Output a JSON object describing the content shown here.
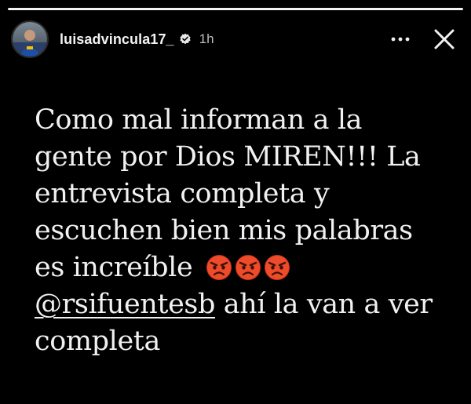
{
  "story": {
    "progress": 1.0,
    "header": {
      "username": "luisadvincula17_",
      "verified": true,
      "time": "1h",
      "avatar_icon": "profile-avatar",
      "more_icon": "more-horizontal-icon",
      "close_icon": "close-icon"
    },
    "caption": {
      "lines": [
        "Como mal informan a la",
        "gente por Dios MIREN!!! La",
        "entrevista completa y",
        "escuchen bien mis palabras",
        "es increíble"
      ],
      "emojis": [
        "😡",
        "😡",
        "😡"
      ],
      "mention": "@rsifuentesb",
      "mention_tail": " ahí la van a ver",
      "last_line": "completa"
    }
  },
  "colors": {
    "background": "#000000",
    "text": "#f1f1f1",
    "muted": "#bdbdbd",
    "verified": "#3897f0",
    "angry_emoji": "#e8482a"
  }
}
